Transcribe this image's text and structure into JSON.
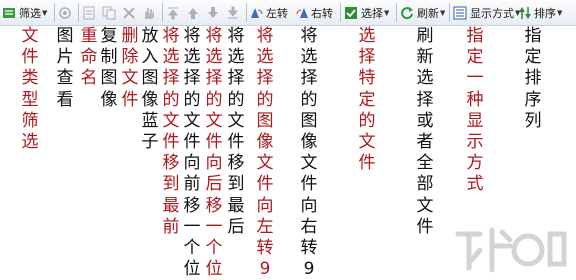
{
  "toolbar": {
    "filter_label": "筛选",
    "rotate_left_label": "左转",
    "rotate_right_label": "右转",
    "select_label": "选择",
    "refresh_label": "刷新",
    "display_mode_label": "显示方式",
    "sort_label": "排序"
  },
  "annotations": {
    "file_type_filter": "文件类型筛选",
    "view_image": "图片查看",
    "rename": "重命名",
    "copy_image": "复制图像",
    "delete_file": "删除文件",
    "zoom_image": "放入图像蓝子",
    "move_to_front": "将选择的文件移到最前",
    "move_forward": "将选择的文件向前移一个位",
    "move_backward": "将选择的文件向后移一个位",
    "move_to_last": "将选择的文件移到最后",
    "rotate_left": "将选择的图像文件向左转9",
    "rotate_right": "将选择的图像文件向右转9",
    "select_specific": "选择特定的文件",
    "refresh_all": "刷新选择或者全部文件",
    "display_mode": "指定一种显示方式",
    "sort_order": "指定排序列"
  },
  "colors": {
    "annotation_red": "#b0171f",
    "annotation_black": "#111111"
  }
}
